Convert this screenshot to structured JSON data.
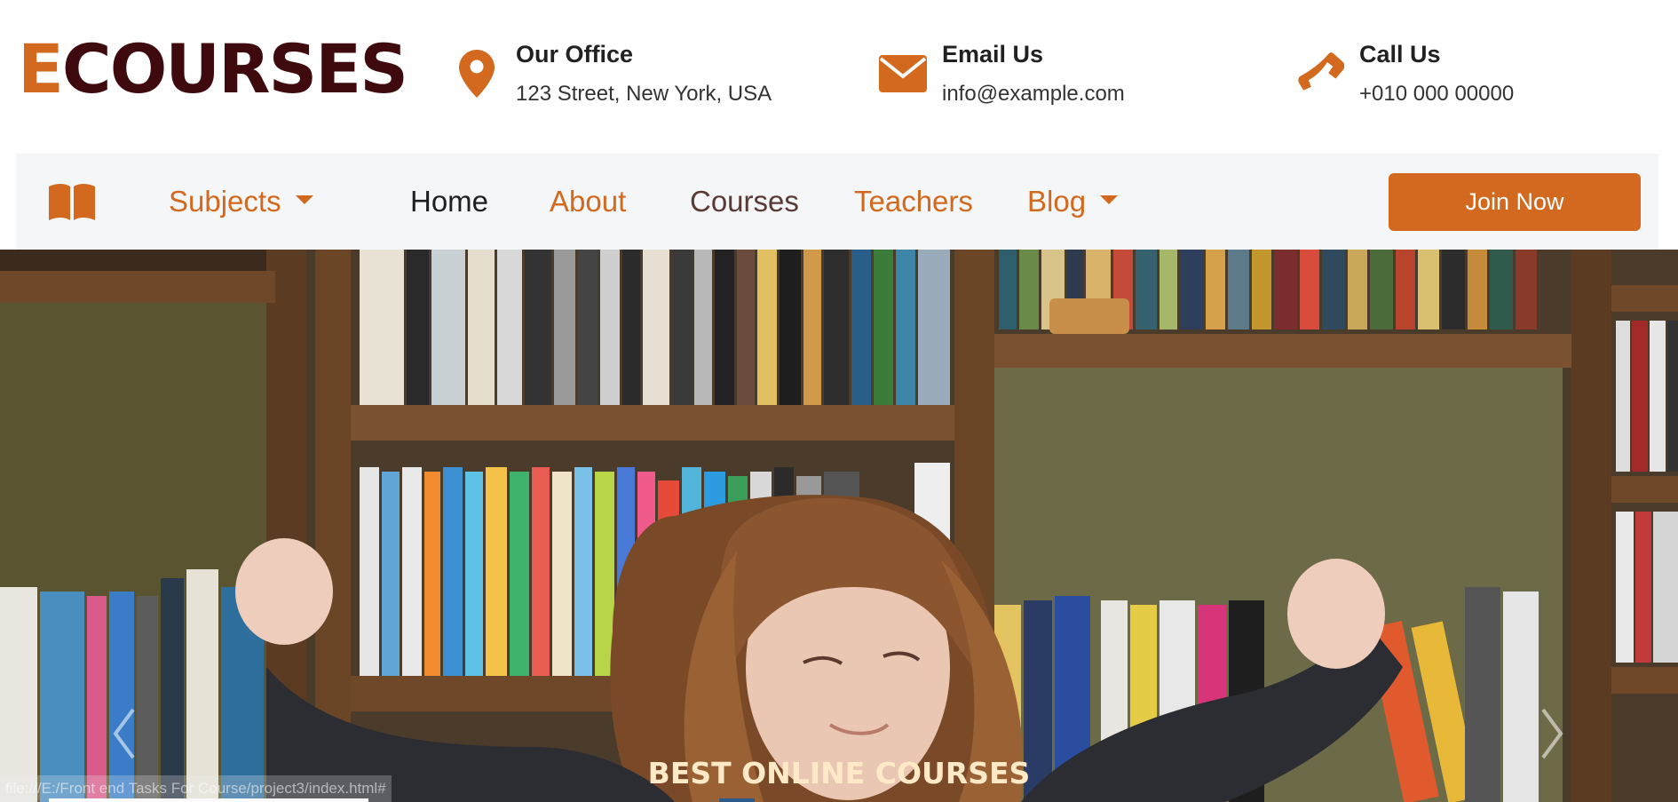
{
  "header": {
    "logo_first": "E",
    "logo_rest": "COURSES",
    "office": {
      "icon": "map-marker-icon",
      "title": "Our Office",
      "value": "123 Street, New York, USA"
    },
    "email": {
      "icon": "envelope-icon",
      "title": "Email Us",
      "value": "info@example.com"
    },
    "call": {
      "icon": "phone-icon",
      "title": "Call Us",
      "value": "+010 000 00000"
    }
  },
  "nav": {
    "brand_icon": "book-icon",
    "items": [
      {
        "label": "Subjects",
        "dropdown": true
      },
      {
        "label": "Home",
        "active": true
      },
      {
        "label": "About"
      },
      {
        "label": "Courses"
      },
      {
        "label": "Teachers"
      },
      {
        "label": "Blog",
        "dropdown": true
      }
    ],
    "cta": "Join Now"
  },
  "hero": {
    "title": "BEST ONLINE COURSES",
    "prev_icon": "chevron-left-icon",
    "next_icon": "chevron-right-icon"
  },
  "status_bar": {
    "url": "file:///E:/Front end Tasks For Course/project3/index.html#"
  },
  "colors": {
    "accent": "#d2691e",
    "logo_dark": "#3f0a0e",
    "navbar_bg": "#f5f6f7",
    "hero_title": "#ffe9c7"
  }
}
